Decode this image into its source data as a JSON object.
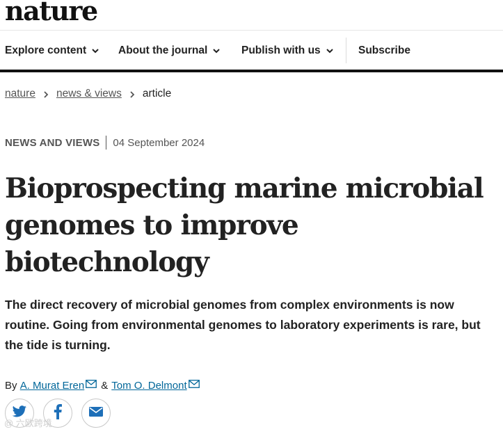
{
  "brand": {
    "logo_text": "nature"
  },
  "nav": {
    "items": [
      {
        "label": "Explore content"
      },
      {
        "label": "About the journal"
      },
      {
        "label": "Publish with us"
      }
    ],
    "subscribe_label": "Subscribe"
  },
  "breadcrumb": {
    "items": [
      {
        "label": "nature"
      },
      {
        "label": "news & views"
      }
    ],
    "current": "article"
  },
  "article": {
    "type": "NEWS AND VIEWS",
    "date": "04 September 2024",
    "title": "Bioprospecting marine microbial genomes to improve biotechnology",
    "standfirst": "The direct recovery of microbial genomes from complex environments is now routine. Going from environmental genomes to laboratory experiments is rare, but the tide is turning.",
    "byline_prefix": "By",
    "authors": [
      {
        "name": "A. Murat Eren"
      },
      {
        "name": "Tom O. Delmont"
      }
    ],
    "author_joiner": "&"
  },
  "share": {
    "buttons": [
      {
        "icon": "twitter-icon",
        "color": "#1d6fb8"
      },
      {
        "icon": "facebook-icon",
        "color": "#1d6fb8"
      },
      {
        "icon": "email-icon",
        "color": "#1d6fb8"
      }
    ]
  },
  "watermark": {
    "text": "@ 六欧跨境"
  },
  "colors": {
    "link": "#006699",
    "text": "#222222",
    "muted": "#555555",
    "rule": "#111111"
  }
}
